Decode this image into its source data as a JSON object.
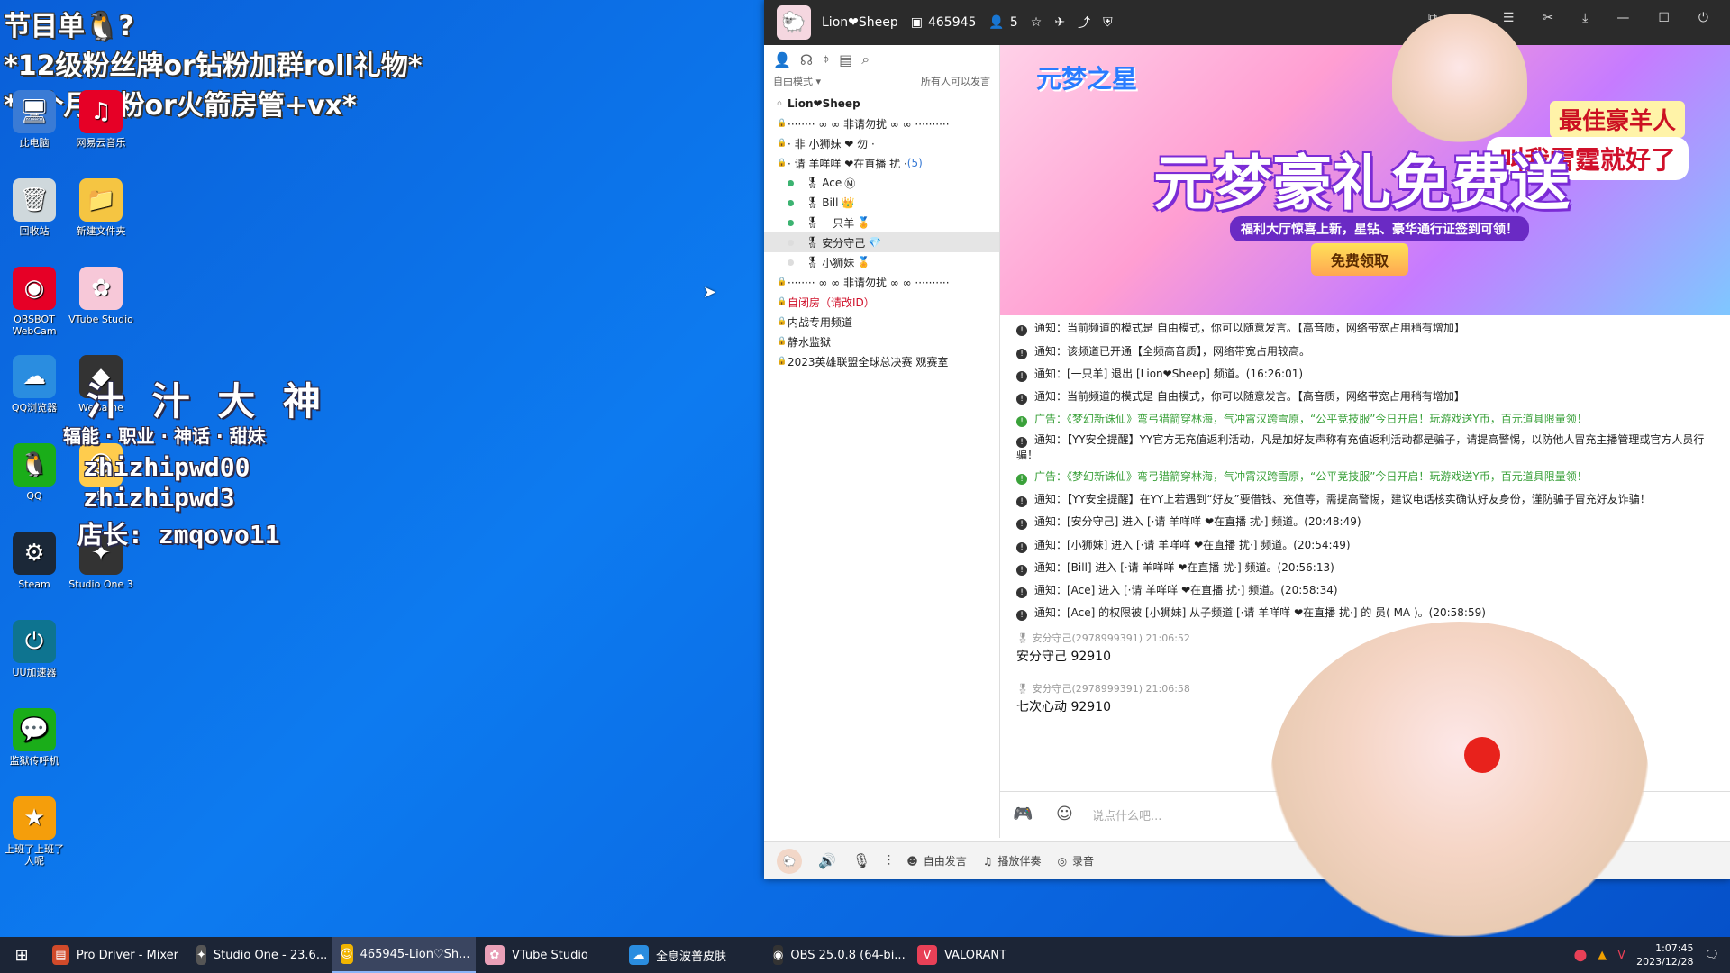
{
  "overlay": {
    "line1": "节目单🐧?",
    "line2": "*12级粉丝牌or钻粉加群roll礼物*",
    "line3": "*3个月钻粉or火箭房管+vx*"
  },
  "promo": {
    "name": "汁 汁 大 神",
    "tags": "辐能 · 职业 · 神话 · 甜妹",
    "id1": "zhizhipwd00",
    "id2": "zhizhipwd3",
    "shop": "店长: zmqovo11"
  },
  "desktop_icons": [
    {
      "label": "此电脑",
      "icon": "computer-icon",
      "glyph": "🖥"
    },
    {
      "label": "网易云音乐",
      "icon": "music-icon",
      "glyph": "♫"
    },
    {
      "label": "回收站",
      "icon": "recycle-bin-icon",
      "glyph": "🗑"
    },
    {
      "label": "新建文件夹",
      "icon": "folder-icon",
      "glyph": "📁"
    },
    {
      "label": "OBSBOT WebCam",
      "icon": "webcam-icon",
      "glyph": "◉"
    },
    {
      "label": "VTube Studio",
      "icon": "vtube-icon",
      "glyph": "✿"
    },
    {
      "label": "QQ浏览器",
      "icon": "browser-icon",
      "glyph": "☁"
    },
    {
      "label": "WeGame",
      "icon": "wegame-icon",
      "glyph": "◆"
    },
    {
      "label": "QQ",
      "icon": "qq-icon",
      "glyph": "🐧"
    },
    {
      "label": "吴",
      "icon": "app-icon",
      "glyph": "☺"
    },
    {
      "label": "Steam",
      "icon": "steam-icon",
      "glyph": "⚙"
    },
    {
      "label": "Studio One 3",
      "icon": "studio-one-icon",
      "glyph": "✦"
    },
    {
      "label": "UU加速器",
      "icon": "uu-icon",
      "glyph": "⏻"
    },
    {
      "label": "监狱传呼机",
      "icon": "wechat-icon",
      "glyph": "💬"
    },
    {
      "label": "上班了上班了人呢",
      "icon": "app-icon",
      "glyph": "★"
    }
  ],
  "yy": {
    "channel_name": "Lion❤Sheep",
    "channel_id": "465945",
    "online_count": "5",
    "mode": "自由模式 ▾",
    "mode_note": "所有人可以发言",
    "tree": [
      {
        "kind": "root",
        "label": "Lion❤Sheep"
      },
      {
        "kind": "chan",
        "label": "········ ∞ ∞ 非请勿扰 ∞ ∞ ··········"
      },
      {
        "kind": "chan",
        "label": "· 非          小狮妹 ❤                 勿 ·"
      },
      {
        "kind": "chan",
        "label": "· 请          羊咩咩 ❤在直播          扰 ·",
        "count": "(5)"
      },
      {
        "kind": "user",
        "label": "Ace",
        "badge": "Ⓜ"
      },
      {
        "kind": "user",
        "label": "Bill",
        "badge": "👑"
      },
      {
        "kind": "user",
        "label": "一只羊",
        "badge": "🏅"
      },
      {
        "kind": "user",
        "label": "安分守己",
        "badge": "💎",
        "selected": true
      },
      {
        "kind": "user",
        "label": "小狮妹",
        "badge": "🏅"
      },
      {
        "kind": "chan",
        "label": "········ ∞ ∞ 非请勿扰 ∞ ∞ ··········"
      },
      {
        "kind": "chan-red",
        "label": "自闭房（请改ID）"
      },
      {
        "kind": "chan",
        "label": "内战专用频道"
      },
      {
        "kind": "chan",
        "label": "静水监狱"
      },
      {
        "kind": "chan",
        "label": "2023英雄联盟全球总决赛 观赛室"
      }
    ],
    "banner": {
      "logo": "元梦之星",
      "title": "元梦豪礼免费送",
      "subtitle": "福利大厅惊喜上新，星钻、豪华通行证签到可领！",
      "button": "免费领取",
      "tag1": "最佳豪羊人",
      "tag2": "叫我雷霆就好了"
    },
    "messages": [
      {
        "type": "notice",
        "text": "通知：当前频道的模式是 自由模式，你可以随意发言。【高音质，网络带宽占用稍有增加】"
      },
      {
        "type": "notice",
        "text": "通知：该频道已开通【全频高音质】，网络带宽占用较高。"
      },
      {
        "type": "notice",
        "text": "通知：[一只羊] 退出 [Lion❤Sheep] 频道。(16:26:01)"
      },
      {
        "type": "notice",
        "text": "通知：当前频道的模式是 自由模式，你可以随意发言。【高音质，网络带宽占用稍有增加】"
      },
      {
        "type": "ad",
        "text": "广告：《梦幻新诛仙》弯弓猎箭穿林海，气冲霄汉跨雪原，“公平竞技服”今日开启！玩游戏送Y币，百元道具限量领！"
      },
      {
        "type": "notice",
        "text": "通知：【YY安全提醒】YY官方无充值返利活动，凡是加好友声称有充值返利活动都是骗子，请提高警惕，以防他人冒充主播管理或官方人员行骗！"
      },
      {
        "type": "ad",
        "text": "广告：《梦幻新诛仙》弯弓猎箭穿林海，气冲霄汉跨雪原，“公平竞技服”今日开启！玩游戏送Y币，百元道具限量领！"
      },
      {
        "type": "notice",
        "text": "通知：【YY安全提醒】在YY上若遇到“好友”要借钱、充值等，需提高警惕，建议电话核实确认好友身份，谨防骗子冒充好友诈骗！"
      },
      {
        "type": "notice",
        "text": "通知：[安分守己] 进入 [·请      羊咩咩 ❤在直播    扰·] 频道。(20:48:49)"
      },
      {
        "type": "notice",
        "text": "通知：[小狮妹] 进入 [·请      羊咩咩 ❤在直播    扰·] 频道。(20:54:49)"
      },
      {
        "type": "notice",
        "text": "通知：[Bill] 进入 [·请      羊咩咩 ❤在直播    扰·] 频道。(20:56:13)"
      },
      {
        "type": "notice",
        "text": "通知：[Ace] 进入 [·请      羊咩咩 ❤在直播    扰·] 频道。(20:58:34)"
      },
      {
        "type": "notice",
        "text": "通知：[Ace] 的权限被 [小狮妹] 从子频道 [·请      羊咩咩 ❤在直播    扰·] 的                                            员( MA )。(20:58:59)"
      }
    ],
    "user_msgs": [
      {
        "meta": "安分守己(2978999391)  21:06:52",
        "text": "安分守己  92910"
      },
      {
        "meta": "安分守己(2978999391)  21:06:58",
        "text": "七次心动  92910"
      }
    ],
    "input_placeholder": "说点什么吧...",
    "bottom": {
      "free_speak": "自由发言",
      "accompany": "播放伴奏",
      "record": "录音"
    }
  },
  "taskbar": {
    "tasks": [
      {
        "label": "Pro Driver - Mixer",
        "icon": "mixer-icon",
        "glyph": "▤",
        "color": "#d04a2a"
      },
      {
        "label": "Studio One - 23.6...",
        "icon": "studio-one-icon",
        "glyph": "✦",
        "color": "#555"
      },
      {
        "label": "465945-Lion♡Sh...",
        "icon": "yy-icon",
        "glyph": "☺",
        "color": "#f0b400",
        "active": true
      },
      {
        "label": "VTube Studio",
        "icon": "vtube-icon",
        "glyph": "✿",
        "color": "#e9a0b8"
      },
      {
        "label": "全息波普皮肤",
        "icon": "browser-icon",
        "glyph": "☁",
        "color": "#2a8de0"
      },
      {
        "label": "OBS 25.0.8 (64-bi...",
        "icon": "obs-icon",
        "glyph": "◉",
        "color": "#333"
      },
      {
        "label": "VALORANT",
        "icon": "valorant-icon",
        "glyph": "V",
        "color": "#e84057"
      }
    ],
    "time": "1:07:45",
    "date": "2023/12/28"
  }
}
